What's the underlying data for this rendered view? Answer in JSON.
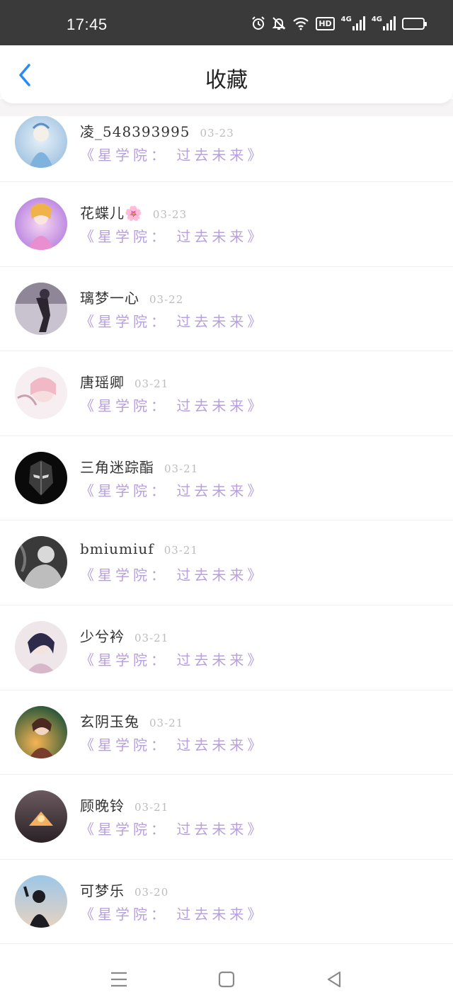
{
  "status_bar": {
    "time": "17:45",
    "icons": [
      "alarm-icon",
      "mute-bell-icon",
      "wifi-icon",
      "hd-icon",
      "signal-4g-icon",
      "signal-4g-icon",
      "battery-icon"
    ],
    "hd_label": "HD",
    "net_label_1": "4G",
    "net_label_2": "4G"
  },
  "header": {
    "title": "收藏",
    "back_icon": "chevron-left-icon",
    "accent_color": "#2a8cf0"
  },
  "list": {
    "title_color": "#b7a0de",
    "items": [
      {
        "name": "凌_548393995",
        "date": "03-23",
        "title": "《星学院： 过去未来》"
      },
      {
        "name": "花蝶儿🌸",
        "date": "03-23",
        "title": "《星学院： 过去未来》"
      },
      {
        "name": "璃梦一心",
        "date": "03-22",
        "title": "《星学院： 过去未来》"
      },
      {
        "name": "唐瑶卿",
        "date": "03-21",
        "title": "《星学院： 过去未来》"
      },
      {
        "name": "三角迷踪酯",
        "date": "03-21",
        "title": "《星学院： 过去未来》"
      },
      {
        "name": "bmiumiuf",
        "date": "03-21",
        "title": "《星学院： 过去未来》"
      },
      {
        "name": "少兮衿",
        "date": "03-21",
        "title": "《星学院： 过去未来》"
      },
      {
        "name": "玄阴玉兔",
        "date": "03-21",
        "title": "《星学院： 过去未来》"
      },
      {
        "name": "顾晚铃",
        "date": "03-21",
        "title": "《星学院： 过去未来》"
      },
      {
        "name": "可梦乐",
        "date": "03-20",
        "title": "《星学院： 过去未来》"
      }
    ]
  },
  "nav_bar": {
    "icons": [
      "menu-icon",
      "home-square-icon",
      "back-triangle-icon"
    ]
  }
}
